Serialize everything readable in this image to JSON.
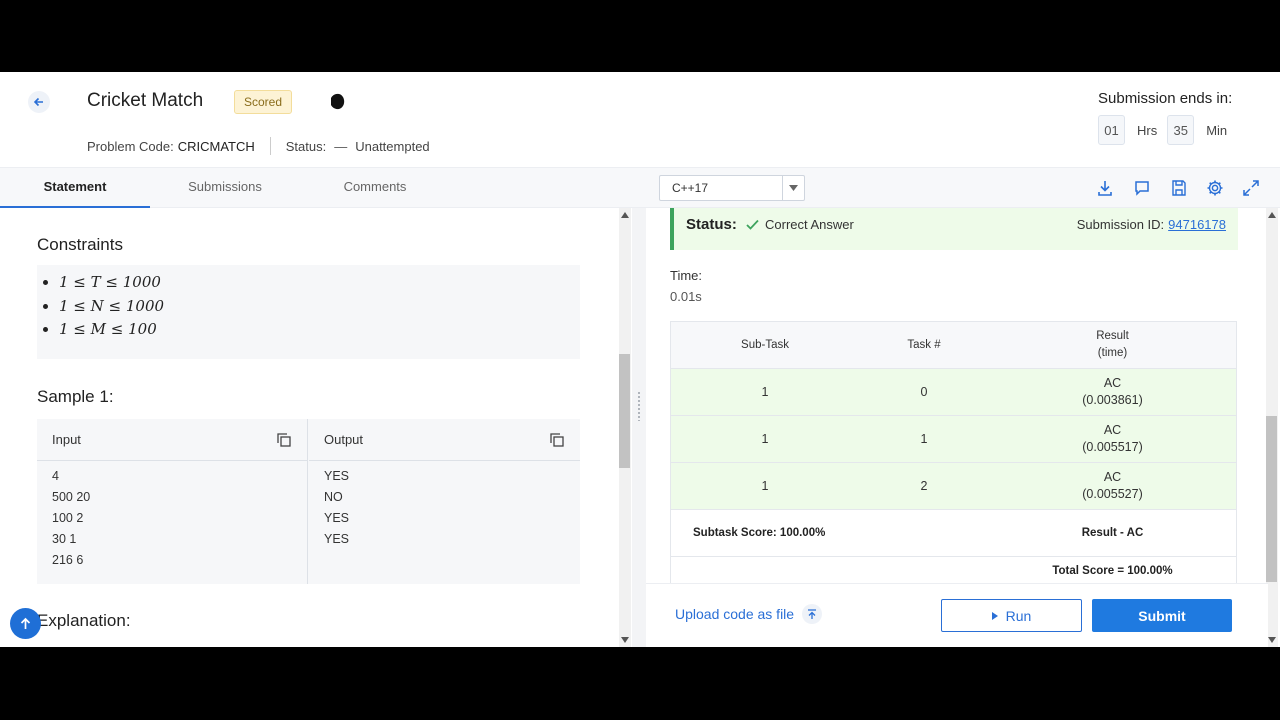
{
  "header": {
    "title": "Cricket Match",
    "badge": "Scored",
    "problem_code_label": "Problem Code:",
    "problem_code": "CRICMATCH",
    "status_label": "Status:",
    "status_dash": "—",
    "status_value": "Unattempted"
  },
  "timer": {
    "label": "Submission ends in:",
    "hours": "01",
    "hours_unit": "Hrs",
    "minutes": "35",
    "minutes_unit": "Min"
  },
  "tabs": [
    "Statement",
    "Submissions",
    "Comments"
  ],
  "editor": {
    "language": "C++17"
  },
  "statement": {
    "constraints_heading": "Constraints",
    "constraints": [
      "1 ≤ T ≤ 1000",
      "1 ≤ N ≤ 1000",
      "1 ≤ M ≤ 100"
    ],
    "sample_heading": "Sample 1:",
    "input_label": "Input",
    "output_label": "Output",
    "input_lines": [
      "4",
      "500 20",
      "100 2",
      "30 1",
      "216 6"
    ],
    "output_lines": [
      "YES",
      "NO",
      "YES",
      "YES"
    ],
    "explanation_heading": "Explanation:"
  },
  "result": {
    "status_label": "Status:",
    "status_value": "Correct Answer",
    "submission_id_label": "Submission ID:",
    "submission_id": "94716178",
    "time_label": "Time:",
    "time_value": "0.01s",
    "table_headers": {
      "subtask": "Sub-Task",
      "task": "Task #",
      "result_line1": "Result",
      "result_line2": "(time)"
    },
    "rows": [
      {
        "subtask": "1",
        "task": "0",
        "result": "AC",
        "time": "(0.003861)"
      },
      {
        "subtask": "1",
        "task": "1",
        "result": "AC",
        "time": "(0.005517)"
      },
      {
        "subtask": "1",
        "task": "2",
        "result": "AC",
        "time": "(0.005527)"
      }
    ],
    "subtask_score": "Subtask Score: 100.00%",
    "subtask_result": "Result - AC",
    "total_score": "Total Score = 100.00%"
  },
  "actions": {
    "upload": "Upload code as file",
    "run": "Run",
    "submit": "Submit"
  },
  "colors": {
    "accent": "#1f7ae0",
    "success_bg": "#eefbe9",
    "success_border": "#3da35d"
  }
}
